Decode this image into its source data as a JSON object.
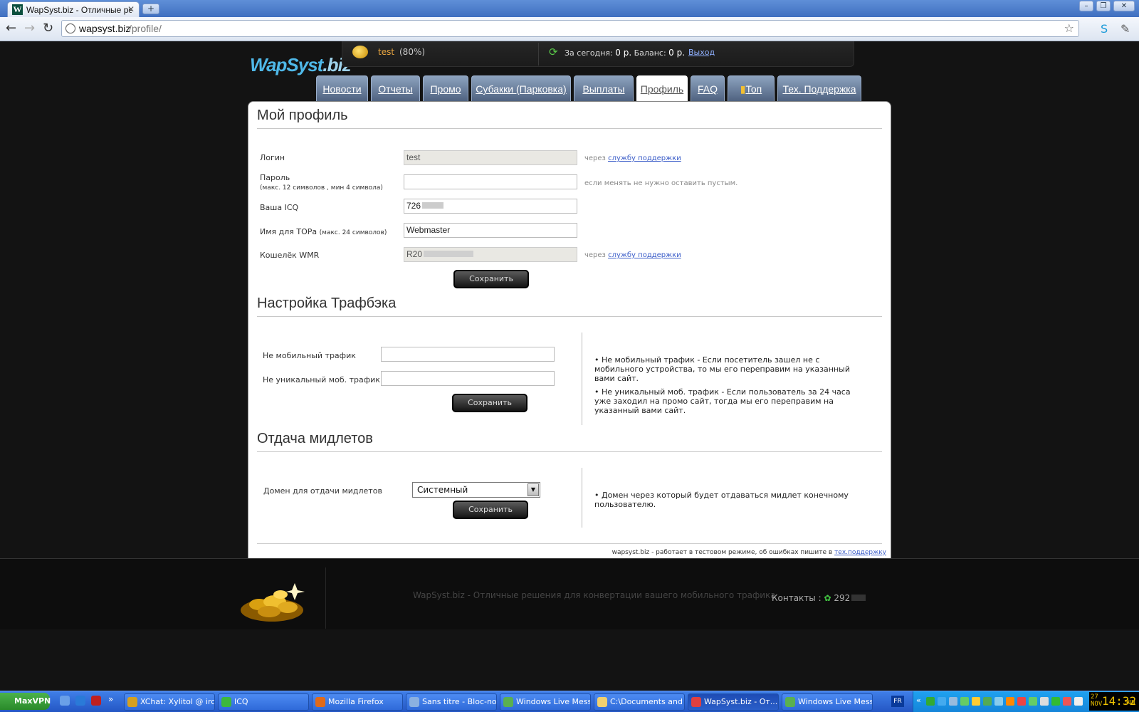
{
  "browser": {
    "tab_title": "WapSyst.biz - Отличные реш",
    "tab_favicon": "W",
    "new_tab": "+",
    "url_host": "wapsyst.biz",
    "url_path": "/profile/",
    "win_min": "–",
    "win_max": "❐",
    "win_close": "✕"
  },
  "site": {
    "logo_part1": "WapSyst",
    "logo_part2": ".biz",
    "user_name": "test",
    "user_percent": "(80%)",
    "today_label": "За сегодня:",
    "today_value": "0 р.",
    "balance_label": "Баланс:",
    "balance_value": "0 р.",
    "exit_link": "Выход"
  },
  "menu": [
    {
      "label": "Новости"
    },
    {
      "label": "Отчеты"
    },
    {
      "label": "Промо"
    },
    {
      "label": "Субакки (Парковка)"
    },
    {
      "label": "Выплаты"
    },
    {
      "label": "Профиль",
      "active": true
    },
    {
      "label": "FAQ"
    },
    {
      "label": "Топ"
    },
    {
      "label": "Тех. Поддержка"
    }
  ],
  "profile": {
    "title": "Мой профиль",
    "login_label": "Логин",
    "login_value": "test",
    "login_hint_prefix": "через",
    "login_hint_link": "службу поддержки",
    "password_label": "Пароль",
    "password_note": "(макс. 12 символов , мин 4 символа)",
    "password_hint": "если менять не нужно оставить пустым.",
    "icq_label": "Ваша ICQ",
    "icq_value": "726",
    "top_name_label": "Имя для ТОРа",
    "top_name_note": "(макс. 24 символов)",
    "top_name_value": "Webmaster",
    "wmr_label": "Кошелёк WMR",
    "wmr_value": "R20",
    "wmr_hint_prefix": "через",
    "wmr_hint_link": "службу поддержки",
    "save": "Сохранить"
  },
  "trafback": {
    "title": "Настройка Трафбэка",
    "nonmobile_label": "Не мобильный трафик",
    "nonunique_label": "Не уникальный моб. трафик",
    "save": "Сохранить",
    "info1": "• Не мобильный трафик - Если посетитель зашел не с мобильного устройства, то мы его переправим на указанный вами сайт.",
    "info2": "• Не уникальный моб. трафик - Если пользователь за 24 часа уже заходил на промо сайт, тогда мы его переправим на указанный вами сайт."
  },
  "midlets": {
    "title": "Отдача мидлетов",
    "domain_label": "Домен для отдачи мидлетов",
    "domain_value": "Системный",
    "save": "Сохранить",
    "info": "• Домен через который будет отдаваться мидлет конечному пользователю."
  },
  "panel_footer": {
    "text": "wapsyst.biz - работает в тестовом режиме, об ошибках пишите в",
    "link": "тех.поддержку"
  },
  "footer": {
    "slogan": "WapSyst.biz - Отличные решения для конвертации вашего мобильного трафика",
    "contacts_label": "Контакты :",
    "contacts_value": "292"
  },
  "taskbar": {
    "start": "MaxVPN",
    "more": "»",
    "buttons": [
      {
        "label": "XChat: Xylitol @ irc....",
        "color": "#d4a020"
      },
      {
        "label": "ICQ",
        "color": "#3cb83c"
      },
      {
        "label": "Mozilla Firefox",
        "color": "#e06a1a"
      },
      {
        "label": "Sans titre - Bloc-notes",
        "color": "#8ab0e0"
      },
      {
        "label": "Windows Live Mess...",
        "color": "#5ab050"
      },
      {
        "label": "C:\\Documents and ...",
        "color": "#f0d070"
      },
      {
        "label": "WapSyst.biz - От...",
        "color": "#e04040",
        "active": true
      },
      {
        "label": "Windows Live Mess...",
        "color": "#5ab050"
      }
    ],
    "lang": "FR",
    "tray_more": "«",
    "clock_day_num": "27",
    "clock_month": "NOV",
    "clock_time": "14:32",
    "clock_weekday": "SUN"
  }
}
